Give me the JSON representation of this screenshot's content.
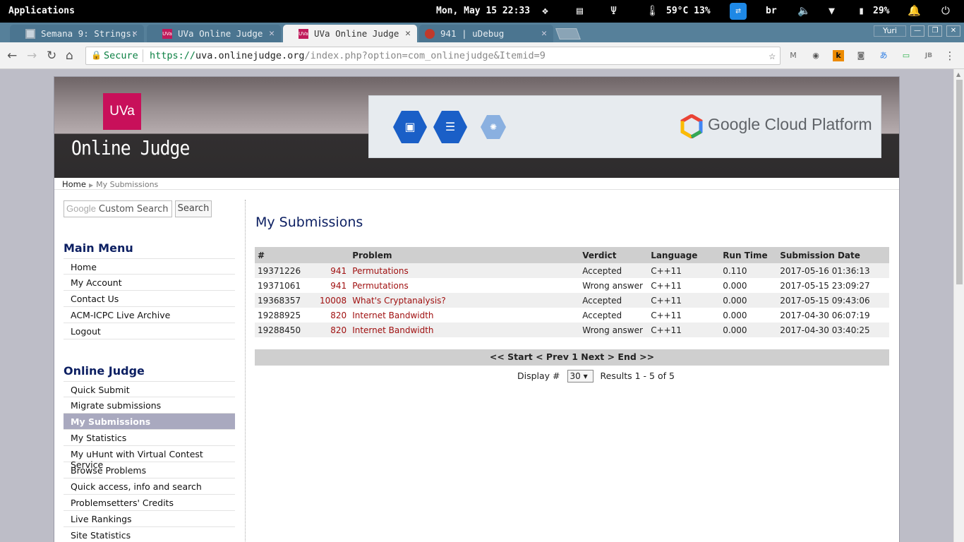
{
  "system_bar": {
    "applications": "Applications",
    "clock": "Mon, May 15  22:33",
    "temperature": "59°C 13%",
    "keyboard_layout": "br",
    "battery": "29%",
    "icons": [
      "dropbox-icon",
      "screenshot-icon",
      "usb-icon",
      "thermometer-icon",
      "teamviewer-icon",
      "volume-icon",
      "wifi-icon",
      "battery-icon",
      "bell-icon",
      "power-icon"
    ]
  },
  "tabs": [
    {
      "title": "Semana 9: Strings:",
      "favicon": "trello-icon"
    },
    {
      "title": "UVa Online Judge",
      "favicon": "uva-icon"
    },
    {
      "title": "UVa Online Judge",
      "favicon": "uva-icon"
    },
    {
      "title": "941 | uDebug",
      "favicon": "udebug-icon"
    }
  ],
  "profile_name": "Yuri",
  "address_bar": {
    "secure_label": "Secure",
    "url_scheme": "https://",
    "url_host": "uva.onlinejudge.org",
    "url_path": "/index.php?option=com_onlinejudge&Itemid=9"
  },
  "site": {
    "logo_short": "UVa",
    "logo_name": "Online Judge",
    "banner_brand": "Google Cloud Platform",
    "accent_color": "#c8105a",
    "title_color": "#0c1f62"
  },
  "breadcrumb": {
    "home": "Home",
    "current": "My Submissions"
  },
  "search": {
    "google_label": "Google",
    "placeholder": "Custom Search",
    "button": "Search"
  },
  "main_menu": {
    "title": "Main Menu",
    "items": [
      "Home",
      "My Account",
      "Contact Us",
      "ACM-ICPC Live Archive",
      "Logout"
    ]
  },
  "online_judge_menu": {
    "title": "Online Judge",
    "items": [
      "Quick Submit",
      "Migrate submissions",
      "My Submissions",
      "My Statistics",
      "My uHunt with Virtual Contest Service",
      "Browse Problems",
      "Quick access, info and search",
      "Problemsetters' Credits",
      "Live Rankings",
      "Site Statistics"
    ],
    "active": "My Submissions"
  },
  "submissions": {
    "title": "My Submissions",
    "columns": [
      "#",
      "Problem",
      "Verdict",
      "Language",
      "Run Time",
      "Submission Date"
    ],
    "rows": [
      {
        "id": "19371226",
        "pnum": "941",
        "pname": "Permutations",
        "verdict": "Accepted",
        "lang": "C++11",
        "time": "0.110",
        "date": "2017-05-16 01:36:13"
      },
      {
        "id": "19371061",
        "pnum": "941",
        "pname": "Permutations",
        "verdict": "Wrong answer",
        "lang": "C++11",
        "time": "0.000",
        "date": "2017-05-15 23:09:27"
      },
      {
        "id": "19368357",
        "pnum": "10008",
        "pname": "What's Cryptanalysis?",
        "verdict": "Accepted",
        "lang": "C++11",
        "time": "0.000",
        "date": "2017-05-15 09:43:06"
      },
      {
        "id": "19288925",
        "pnum": "820",
        "pname": "Internet Bandwidth",
        "verdict": "Accepted",
        "lang": "C++11",
        "time": "0.000",
        "date": "2017-04-30 06:07:19"
      },
      {
        "id": "19288450",
        "pnum": "820",
        "pname": "Internet Bandwidth",
        "verdict": "Wrong answer",
        "lang": "C++11",
        "time": "0.000",
        "date": "2017-04-30 03:40:25"
      }
    ],
    "pager": "<< Start < Prev 1 Next > End >>",
    "display_label": "Display #",
    "display_value": "30",
    "results_text": "Results 1 - 5 of 5"
  }
}
